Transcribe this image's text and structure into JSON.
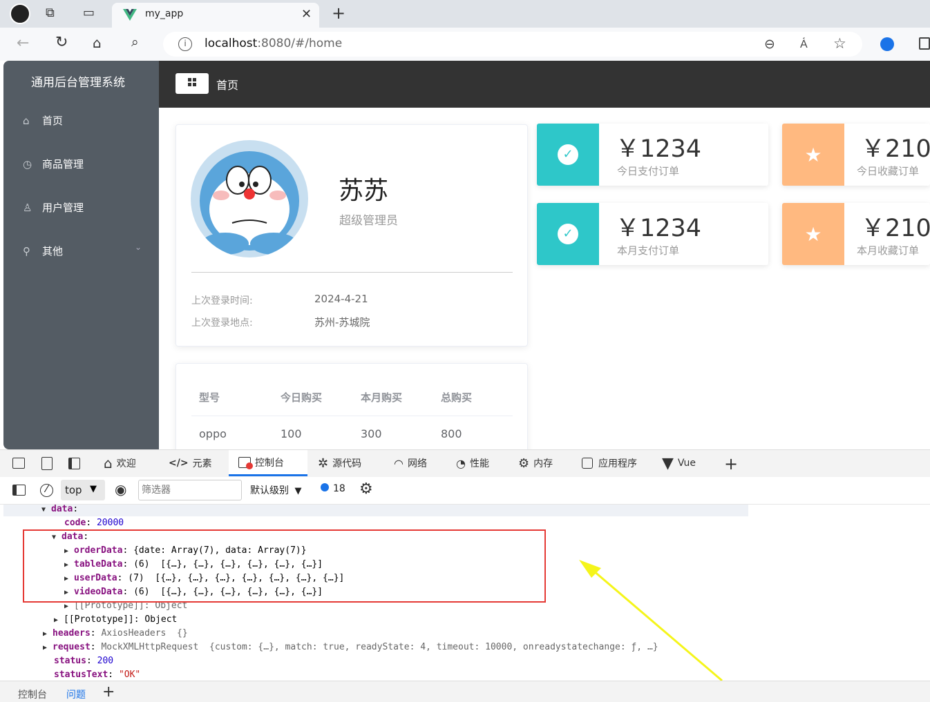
{
  "browser": {
    "tab_title": "my_app",
    "url_host": "localhost",
    "url_rest": ":8080/#/home"
  },
  "app": {
    "title": "通用后台管理系统",
    "breadcrumb": "首页",
    "menu": [
      {
        "label": "首页",
        "icon": "home-icon"
      },
      {
        "label": "商品管理",
        "icon": "video-play-icon"
      },
      {
        "label": "用户管理",
        "icon": "user-icon"
      },
      {
        "label": "其他",
        "icon": "location-icon"
      }
    ],
    "user": {
      "name": "苏苏",
      "role": "超级管理员",
      "last_login_time_label": "上次登录时间:",
      "last_login_time": "2024-4-21",
      "last_login_place_label": "上次登录地点:",
      "last_login_place": "苏州-苏城院"
    },
    "stats": [
      {
        "value": "￥1234",
        "label": "今日支付订单",
        "color": "#2ec7c9",
        "icon": "success-icon"
      },
      {
        "value": "￥210",
        "label": "今日收藏订单",
        "color": "#ffb980",
        "icon": "star-icon"
      },
      {
        "value": "￥1234",
        "label": "本月支付订单",
        "color": "#2ec7c9",
        "icon": "success-icon"
      },
      {
        "value": "￥210",
        "label": "本月收藏订单",
        "color": "#ffb980",
        "icon": "star-icon"
      }
    ],
    "table": {
      "headers": [
        "型号",
        "今日购买",
        "本月购买",
        "总购买"
      ],
      "rows": [
        [
          "oppo",
          "100",
          "300",
          "800"
        ]
      ]
    }
  },
  "devtools": {
    "tabs": [
      "欢迎",
      "元素",
      "控制台",
      "源代码",
      "网络",
      "性能",
      "内存",
      "应用程序",
      "Vue"
    ],
    "context": "top",
    "filter_placeholder": "筛选器",
    "level": "默认级别",
    "message_count": "18",
    "bottom_tabs": [
      "控制台",
      "问题"
    ],
    "lines": {
      "data": "data",
      "code_key": "code",
      "code_val": "20000",
      "data2": "data",
      "orderData": "orderData",
      "orderData_val": "{date: Array(7), data: Array(7)}",
      "tableData": "tableData",
      "tableData_val": "(6)  [{…}, {…}, {…}, {…}, {…}, {…}]",
      "userData": "userData",
      "userData_val": "(7)  [{…}, {…}, {…}, {…}, {…}, {…}, {…}]",
      "videoData": "videoData",
      "videoData_val": "(6)  [{…}, {…}, {…}, {…}, {…}, {…}]",
      "proto1": "[[Prototype]]: Object",
      "proto2": "[[Prototype]]: Object",
      "headers_key": "headers",
      "headers_val": "AxiosHeaders  {}",
      "request_key": "request",
      "request_val": "MockXMLHttpRequest  {custom: {…}, match: true, readyState: 4, timeout: 10000, onreadystatechange: ƒ, …}",
      "status_key": "status",
      "status_val": "200",
      "statusText_key": "statusText",
      "statusText_val": "\"OK\""
    }
  },
  "annotation": {
    "box_color": "#e53935",
    "arrow_color": "#f5f51a"
  }
}
